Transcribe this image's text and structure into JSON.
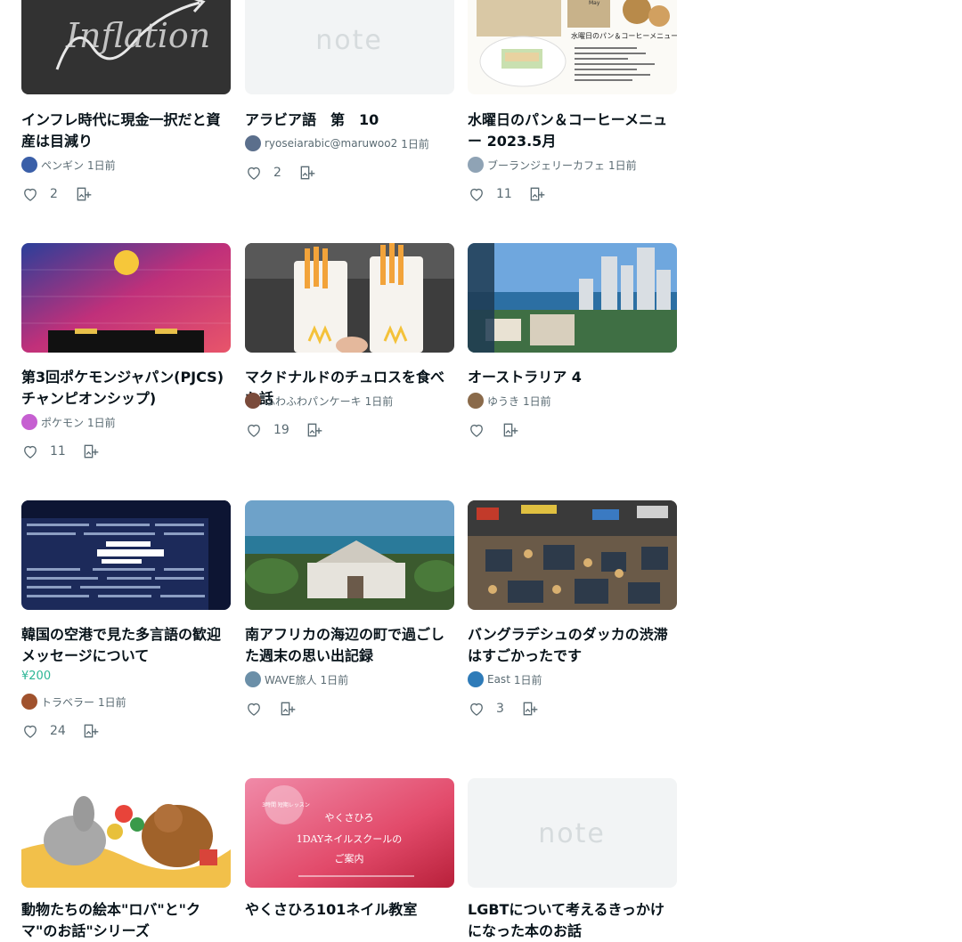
{
  "cards": [
    {
      "title": "インフレ時代に現金一択だと資産は目減り",
      "price": "",
      "author": "ペンギン",
      "time": "1日前",
      "likes": "2",
      "thumb": "inflation",
      "avatar_color": "#3a5fa8"
    },
    {
      "title": "アラビア語　第　10",
      "price": "",
      "author": "ryoseiarabic@maruwoo2",
      "time": "1日前",
      "likes": "2",
      "thumb": "note-placeholder",
      "avatar_color": "#5b6f8c"
    },
    {
      "title": "水曜日のパン＆コーヒーメニュー 2023.5月",
      "price": "",
      "author": "ブーランジェリーカフェ",
      "time": "1日前",
      "likes": "11",
      "thumb": "menu",
      "avatar_color": "#8fa3b5"
    },
    {
      "title": "第3回ポケモンジャパン(PJCS)チャンピオンシップ)",
      "price": "",
      "author": "ポケモン",
      "time": "1日前",
      "likes": "11",
      "thumb": "champions",
      "avatar_color": "#c65fd1"
    },
    {
      "title": "マクドナルドのチュロスを食べた話",
      "price": "",
      "author": "ふわふわパンケーキ",
      "time": "1日前",
      "likes": "19",
      "thumb": "churros",
      "avatar_color": "#7a4a3a"
    },
    {
      "title": "オーストラリア 4",
      "price": "",
      "author": "ゆうき",
      "time": "1日前",
      "likes": "",
      "thumb": "australia",
      "avatar_color": "#8a6a4a"
    },
    {
      "title": "韓国の空港で見た多言語の歓迎メッセージについて",
      "price": "¥200",
      "author": "トラベラー",
      "time": "1日前",
      "likes": "24",
      "thumb": "korea",
      "avatar_color": "#a0522d"
    },
    {
      "title": "南アフリカの海辺の町で過ごした週末の思い出記録",
      "price": "",
      "author": "WAVE旅人",
      "time": "1日前",
      "likes": "",
      "thumb": "beach",
      "avatar_color": "#6b8fa8"
    },
    {
      "title": "バングラデシュのダッカの渋滞はすごかったです",
      "price": "",
      "author": "East",
      "time": "1日前",
      "likes": "3",
      "thumb": "traffic",
      "avatar_color": "#2e7bb8"
    },
    {
      "title": "動物たちの絵本\"ロバ\"と\"クマ\"のお話\"シリーズ",
      "price": "",
      "author": "",
      "time": "",
      "likes": "",
      "thumb": "illustration",
      "avatar_color": "#888888"
    },
    {
      "title": "やくさひろ101ネイル教室",
      "price": "",
      "author": "",
      "time": "",
      "likes": "",
      "thumb": "nail",
      "avatar_color": "#888888"
    },
    {
      "title": "LGBTについて考えるきっかけになった本のお話",
      "price": "",
      "author": "",
      "time": "",
      "likes": "",
      "thumb": "note-placeholder",
      "avatar_color": "#888888"
    }
  ],
  "placeholder_logo": "note",
  "nail_text": {
    "line1": "やくさひろ",
    "line2": "1DAYネイルスクールの",
    "line3": "ご案内",
    "badge": "3時間 短期レッスン"
  },
  "menu_text": {
    "month": "May",
    "heading": "水曜日のパン＆コーヒーメニュー"
  },
  "colors": {
    "accent": "#2cb696",
    "text": "#08131a",
    "subtext": "#5a6b73"
  }
}
